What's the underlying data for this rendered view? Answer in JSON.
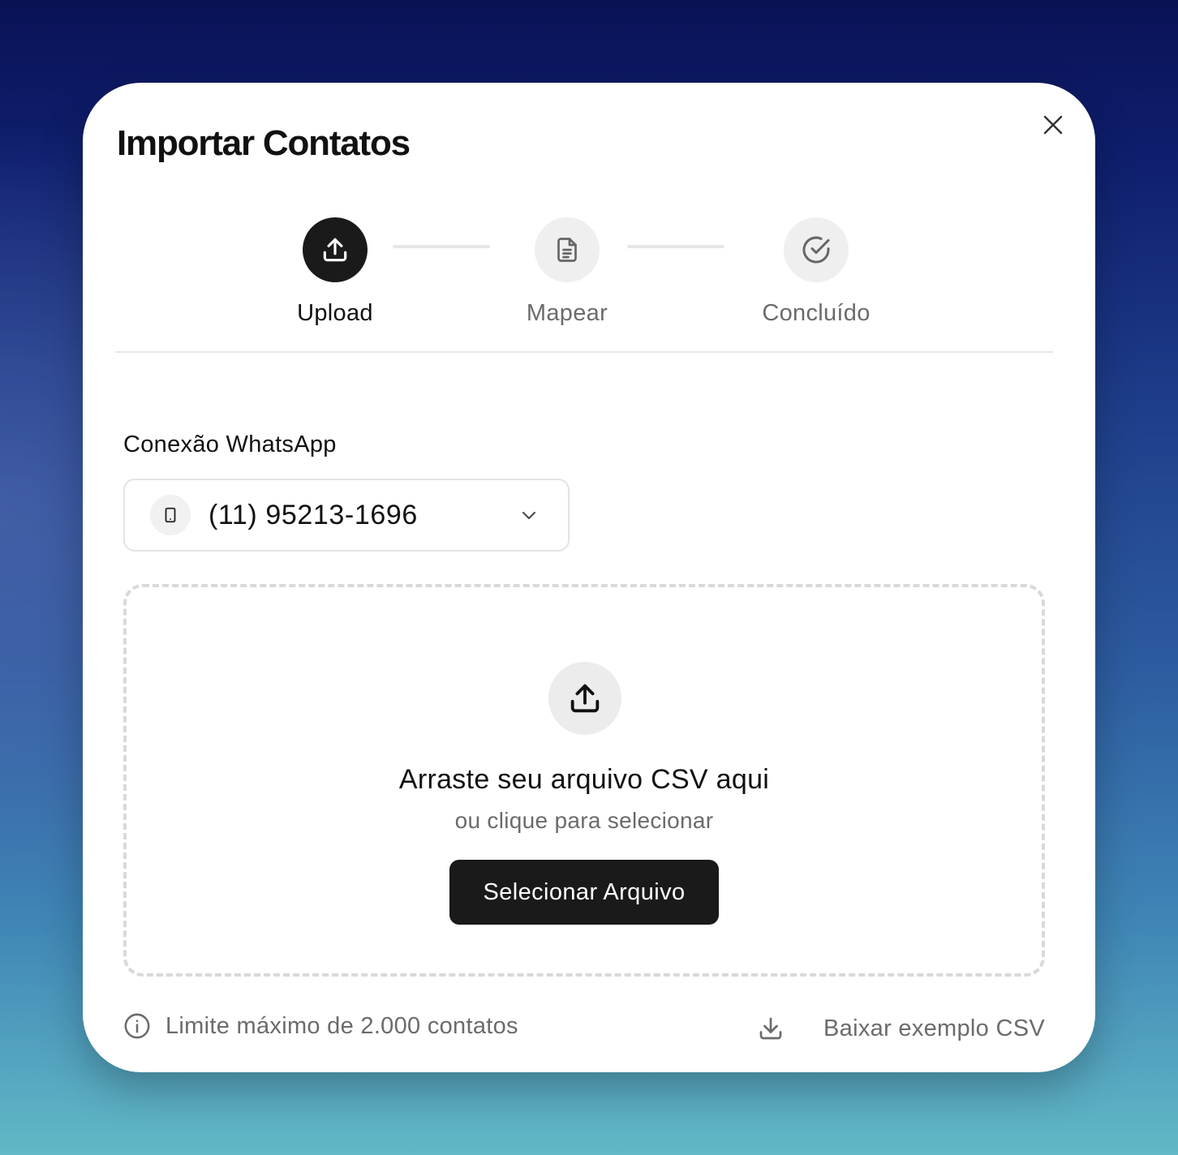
{
  "modal": {
    "title": "Importar Contatos",
    "close_icon": "close-icon"
  },
  "steps": [
    {
      "label": "Upload",
      "icon": "upload-icon",
      "state": "active"
    },
    {
      "label": "Mapear",
      "icon": "document-icon",
      "state": "pending"
    },
    {
      "label": "Concluído",
      "icon": "check-circle-icon",
      "state": "pending"
    }
  ],
  "connection": {
    "label": "Conexão WhatsApp",
    "selected_value": "(11) 95213-1696",
    "icon": "phone-icon",
    "dropdown_icon": "chevron-down-icon"
  },
  "dropzone": {
    "icon": "upload-icon",
    "title": "Arraste seu arquivo CSV aqui",
    "subtitle": "ou clique para selecionar",
    "button_label": "Selecionar Arquivo"
  },
  "footer": {
    "limit_text": "Limite máximo de 2.000 contatos",
    "limit_icon": "info-icon",
    "download_label": "Baixar exemplo CSV",
    "download_icon": "download-icon"
  },
  "colors": {
    "primary": "#1a1a1a",
    "muted_text": "#6b6b6b",
    "step_inactive_bg": "#efefef"
  }
}
